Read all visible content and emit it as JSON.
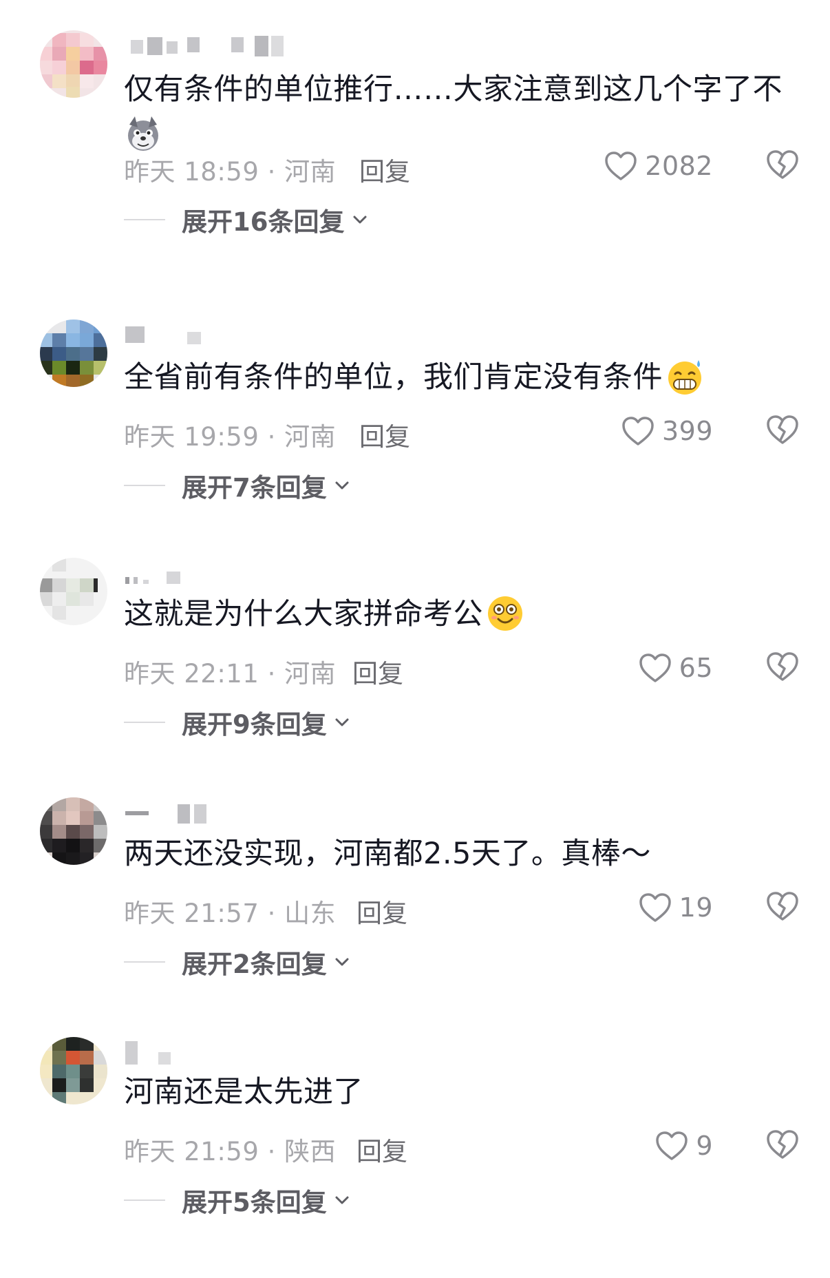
{
  "comments": [
    {
      "text": "仅有条件的单位推行……大家注意到这几个字了不",
      "emoji": "wolf-emoji",
      "time": "昨天 18:59",
      "location": "河南",
      "meta": "昨天 18:59 · 河南",
      "reply_label": "回复",
      "likes": "2082",
      "expand_label": "展开16条回复"
    },
    {
      "text": "全省前有条件的单位，我们肯定没有条件",
      "emoji": "grin-sweat-emoji",
      "time": "昨天 19:59",
      "location": "河南",
      "meta": "昨天 19:59 · 河南",
      "reply_label": "回复",
      "likes": "399",
      "expand_label": "展开7条回复"
    },
    {
      "text": "这就是为什么大家拼命考公",
      "emoji": "dizzy-face-emoji",
      "time": "昨天 22:11",
      "location": "河南",
      "meta": "昨天 22:11 · 河南",
      "reply_label": "回复",
      "likes": "65",
      "expand_label": "展开9条回复"
    },
    {
      "text": "两天还没实现，河南都2.5天了。真棒～",
      "emoji": "",
      "time": "昨天 21:57",
      "location": "山东",
      "meta": "昨天 21:57 · 山东",
      "reply_label": "回复",
      "likes": "19",
      "expand_label": "展开2条回复"
    },
    {
      "text": "河南还是太先进了",
      "emoji": "",
      "time": "昨天 21:59",
      "location": "陕西",
      "meta": "昨天 21:59 · 陕西",
      "reply_label": "回复",
      "likes": "9",
      "expand_label": "展开5条回复"
    }
  ],
  "colors": {
    "text": "#161823",
    "meta": "#a7a7ab",
    "reply": "#6b6b70",
    "icon": "#8a8a8f"
  },
  "icons": {
    "like": "heart-outline-icon",
    "dislike": "broken-heart-icon",
    "expand": "chevron-down-icon"
  }
}
